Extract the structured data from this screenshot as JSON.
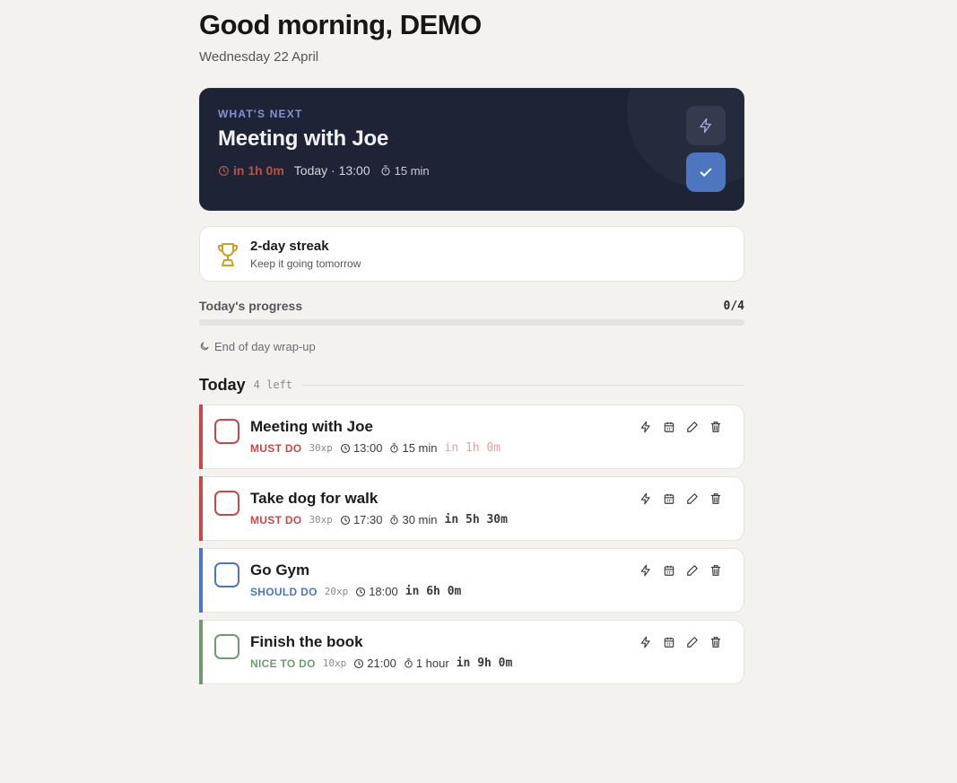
{
  "header": {
    "greeting": "Good morning, DEMO",
    "date": "Wednesday 22 April"
  },
  "next": {
    "label": "WHAT'S NEXT",
    "title": "Meeting with Joe",
    "countdown": "in 1h 0m",
    "when": "Today · 13:00",
    "duration": "15 min"
  },
  "streak": {
    "title": "2-day streak",
    "subtitle": "Keep it going tomorrow"
  },
  "progress": {
    "label": "Today's progress",
    "count": "0/4",
    "fraction": 0
  },
  "wrapup": {
    "label": "End of day wrap-up"
  },
  "section": {
    "title": "Today",
    "left": "4 left"
  },
  "colors": {
    "must": "#c44a4a",
    "should": "#4e76c0",
    "nice": "#6f9a73"
  },
  "tasks": [
    {
      "title": "Meeting with Joe",
      "priority": "MUST DO",
      "xp": "30xp",
      "time": "13:00",
      "duration": "15 min",
      "relative": "in 1h 0m"
    },
    {
      "title": "Take dog for walk",
      "priority": "MUST DO",
      "xp": "30xp",
      "time": "17:30",
      "duration": "30 min",
      "relative": "in 5h 30m"
    },
    {
      "title": "Go Gym",
      "priority": "SHOULD DO",
      "xp": "20xp",
      "time": "18:00",
      "relative": "in 6h 0m"
    },
    {
      "title": "Finish the book",
      "priority": "NICE TO DO",
      "xp": "10xp",
      "time": "21:00",
      "duration": "1 hour",
      "relative": "in 9h 0m"
    }
  ],
  "icons": [
    "clock-icon",
    "timer-icon",
    "bolt-icon",
    "check-icon",
    "trophy-icon",
    "moon-icon",
    "calendar-icon",
    "pencil-icon",
    "trash-icon"
  ]
}
